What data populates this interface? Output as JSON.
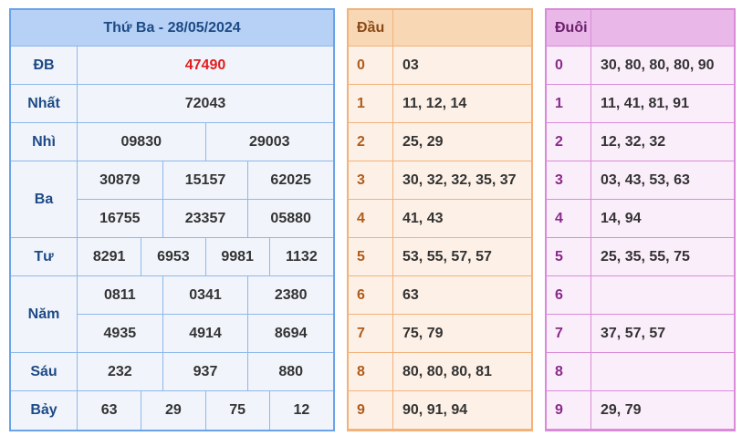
{
  "results": {
    "header": "Thứ Ba - 28/05/2024",
    "prizes": [
      {
        "label": "ĐB",
        "lines": [
          [
            "47490"
          ]
        ]
      },
      {
        "label": "Nhất",
        "lines": [
          [
            "72043"
          ]
        ]
      },
      {
        "label": "Nhì",
        "lines": [
          [
            "09830",
            "29003"
          ]
        ]
      },
      {
        "label": "Ba",
        "lines": [
          [
            "30879",
            "15157",
            "62025"
          ],
          [
            "16755",
            "23357",
            "05880"
          ]
        ]
      },
      {
        "label": "Tư",
        "lines": [
          [
            "8291",
            "6953",
            "9981",
            "1132"
          ]
        ]
      },
      {
        "label": "Năm",
        "lines": [
          [
            "0811",
            "0341",
            "2380"
          ],
          [
            "4935",
            "4914",
            "8694"
          ]
        ]
      },
      {
        "label": "Sáu",
        "lines": [
          [
            "232",
            "937",
            "880"
          ]
        ]
      },
      {
        "label": "Bảy",
        "lines": [
          [
            "63",
            "29",
            "75",
            "12"
          ]
        ]
      }
    ]
  },
  "dau": {
    "header": "Đầu",
    "rows": [
      {
        "k": "0",
        "v": "03"
      },
      {
        "k": "1",
        "v": "11, 12, 14"
      },
      {
        "k": "2",
        "v": "25, 29"
      },
      {
        "k": "3",
        "v": "30, 32, 32, 35, 37"
      },
      {
        "k": "4",
        "v": "41, 43"
      },
      {
        "k": "5",
        "v": "53, 55, 57, 57"
      },
      {
        "k": "6",
        "v": "63"
      },
      {
        "k": "7",
        "v": "75, 79"
      },
      {
        "k": "8",
        "v": "80, 80, 80, 81"
      },
      {
        "k": "9",
        "v": "90, 91, 94"
      }
    ]
  },
  "duoi": {
    "header": "Đuôi",
    "rows": [
      {
        "k": "0",
        "v": "30, 80, 80, 80, 90"
      },
      {
        "k": "1",
        "v": "11, 41, 81, 91"
      },
      {
        "k": "2",
        "v": "12, 32, 32"
      },
      {
        "k": "3",
        "v": "03, 43, 53, 63"
      },
      {
        "k": "4",
        "v": "14, 94"
      },
      {
        "k": "5",
        "v": "25, 35, 55, 75"
      },
      {
        "k": "6",
        "v": ""
      },
      {
        "k": "7",
        "v": "37, 57, 57"
      },
      {
        "k": "8",
        "v": ""
      },
      {
        "k": "9",
        "v": "29, 79"
      }
    ]
  },
  "colors": {
    "special_prize": "#e11d1d",
    "results_accent": "#6aa3e8",
    "dau_accent": "#f2b27a",
    "duoi_accent": "#d98bd9"
  }
}
